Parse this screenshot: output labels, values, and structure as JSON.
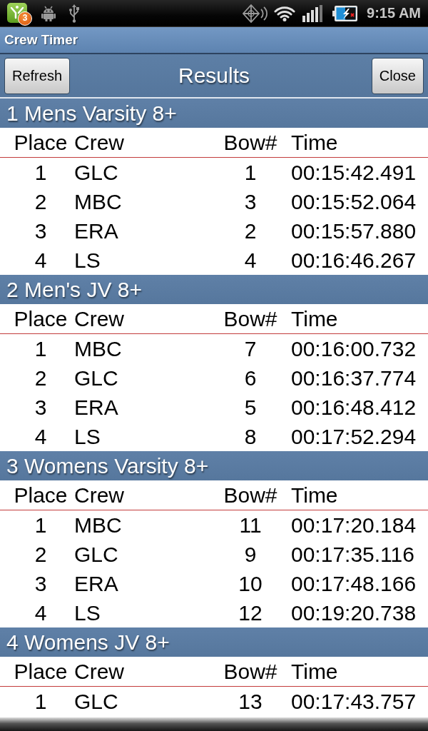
{
  "status_bar": {
    "notification_count": "3",
    "time": "9:15 AM"
  },
  "window": {
    "title": "Crew Timer"
  },
  "toolbar": {
    "left_button": "Refresh",
    "title": "Results",
    "right_button": "Close"
  },
  "sections": [
    {
      "title": "1 Mens Varsity 8+",
      "columns": [
        "Place",
        "Crew",
        "Bow#",
        "Time"
      ],
      "rows": [
        {
          "place": "1",
          "crew": "GLC",
          "bow": "1",
          "time": "00:15:42.491"
        },
        {
          "place": "2",
          "crew": "MBC",
          "bow": "3",
          "time": "00:15:52.064"
        },
        {
          "place": "3",
          "crew": "ERA",
          "bow": "2",
          "time": "00:15:57.880"
        },
        {
          "place": "4",
          "crew": "LS",
          "bow": "4",
          "time": "00:16:46.267"
        }
      ]
    },
    {
      "title": "2 Men's JV 8+",
      "columns": [
        "Place",
        "Crew",
        "Bow#",
        "Time"
      ],
      "rows": [
        {
          "place": "1",
          "crew": "MBC",
          "bow": "7",
          "time": "00:16:00.732"
        },
        {
          "place": "2",
          "crew": "GLC",
          "bow": "6",
          "time": "00:16:37.774"
        },
        {
          "place": "3",
          "crew": "ERA",
          "bow": "5",
          "time": "00:16:48.412"
        },
        {
          "place": "4",
          "crew": "LS",
          "bow": "8",
          "time": "00:17:52.294"
        }
      ]
    },
    {
      "title": "3 Womens Varsity 8+",
      "columns": [
        "Place",
        "Crew",
        "Bow#",
        "Time"
      ],
      "rows": [
        {
          "place": "1",
          "crew": "MBC",
          "bow": "11",
          "time": "00:17:20.184"
        },
        {
          "place": "2",
          "crew": "GLC",
          "bow": "9",
          "time": "00:17:35.116"
        },
        {
          "place": "3",
          "crew": "ERA",
          "bow": "10",
          "time": "00:17:48.166"
        },
        {
          "place": "4",
          "crew": "LS",
          "bow": "12",
          "time": "00:19:20.738"
        }
      ]
    },
    {
      "title": "4 Womens JV 8+",
      "columns": [
        "Place",
        "Crew",
        "Bow#",
        "Time"
      ],
      "rows": [
        {
          "place": "1",
          "crew": "GLC",
          "bow": "13",
          "time": "00:17:43.757"
        }
      ]
    }
  ]
}
